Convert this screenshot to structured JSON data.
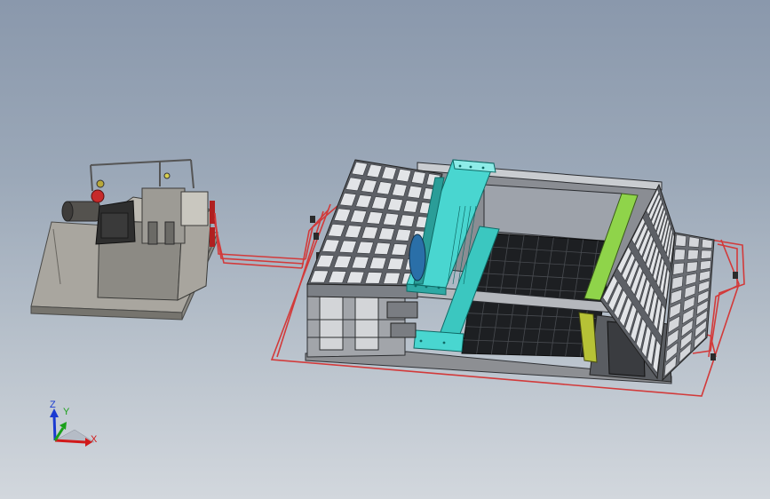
{
  "viewport": {
    "background_top": "#8a98ac",
    "background_bottom": "#d2d7dd"
  },
  "model": {
    "frame_color": "#c8cbcf",
    "pipe_color": "#d23a3a",
    "gantry_color": "#49d6d0",
    "rail_color": "#8fd44a",
    "hydraulic_unit_color": "#8c8a84"
  },
  "triad": {
    "x_label": "X",
    "y_label": "Y",
    "z_label": "Z",
    "x_color": "#d11a1a",
    "y_color": "#1aa01a",
    "z_color": "#1a3ad1"
  }
}
